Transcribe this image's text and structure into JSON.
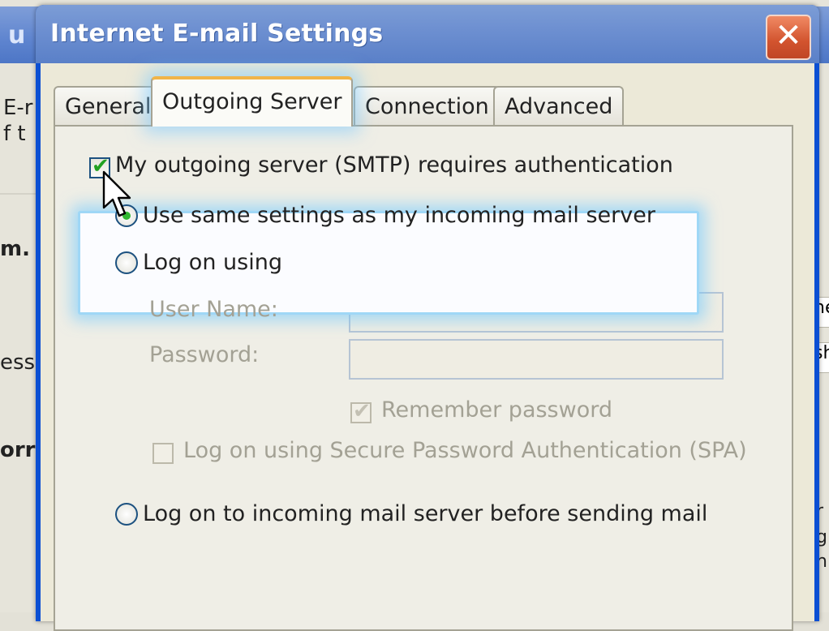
{
  "background_window": {
    "title_fragment": "u",
    "left_texts": [
      "E-r",
      "f t",
      "m.",
      "ess",
      "orr"
    ],
    "right_texts": [
      "ne",
      "sh",
      "r",
      "g",
      "n"
    ]
  },
  "dialog": {
    "title": "Internet E-mail Settings",
    "close_glyph": "✕",
    "tabs": [
      {
        "label": "General",
        "active": false
      },
      {
        "label": "Outgoing Server",
        "active": true
      },
      {
        "label": "Connection",
        "active": false
      },
      {
        "label": "Advanced",
        "active": false
      }
    ],
    "smtp_auth_checkbox": {
      "label": "My outgoing server (SMTP) requires authentication",
      "checked": true
    },
    "radio_same_settings": {
      "label": "Use same settings as my incoming mail server",
      "selected": true
    },
    "radio_log_on_using": {
      "label": "Log on using",
      "selected": false
    },
    "user_name": {
      "label": "User Name:",
      "value": ""
    },
    "password": {
      "label": "Password:",
      "value": ""
    },
    "remember_password": {
      "label": "Remember password",
      "checked": true,
      "enabled": false
    },
    "spa_checkbox": {
      "label": "Log on using Secure Password Authentication (SPA)",
      "checked": false,
      "enabled": false
    },
    "radio_incoming_before_sending": {
      "label": "Log on to incoming mail server before sending mail",
      "selected": false
    }
  },
  "icons": {
    "close": "close-icon",
    "cursor": "mouse-pointer-icon"
  },
  "colors": {
    "title_bar": "#6e90d1",
    "highlight_glow": "#9fd7f6",
    "check_green": "#21a121",
    "close_red": "#d2532e"
  }
}
